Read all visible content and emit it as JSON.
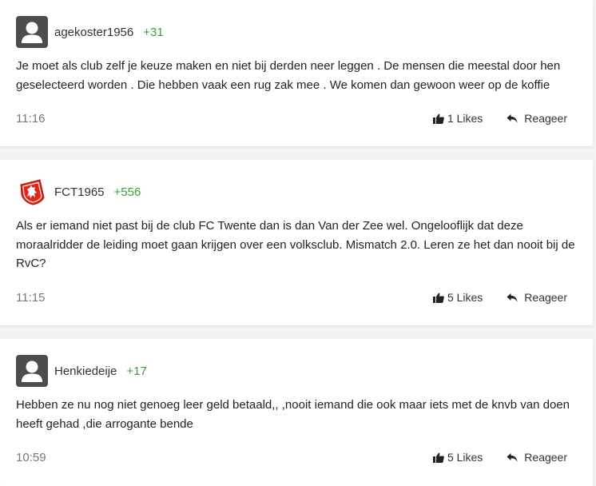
{
  "comments": [
    {
      "username": "agekoster1956",
      "score": "+31",
      "avatar_icon": "default-user-avatar",
      "text": "Je moet als club zelf je keuze maken en niet bij derden neer leggen . De mensen die meestal door hen geselecteerd worden . Die hebben vaak een rug zak mee . We komen dan gewoon weer op de koffie",
      "time": "11:16",
      "likes": "1 Likes",
      "reply": "Reageer"
    },
    {
      "username": "FCT1965",
      "score": "+556",
      "avatar_icon": "fc-twente-logo",
      "text": "Als er iemand niet past bij de club FC Twente dan is dan Van der Zee wel. Ongelooflijk dat deze moraalridder de leiding moet gaan krijgen over een volksclub. Mismatch 2.0. Leren ze het dan nooit bij de RvC?",
      "time": "11:15",
      "likes": "5 Likes",
      "reply": "Reageer"
    },
    {
      "username": "Henkiedeije",
      "score": "+17",
      "avatar_icon": "default-user-avatar",
      "text": "Hebben ze nu nog niet genoeg leer geld betaald,, ,nooit iemand die ook maar iets met de knvb van doen heeft gehad ,die arrogante bende",
      "time": "10:59",
      "likes": "5 Likes",
      "reply": "Reageer"
    }
  ],
  "colors": {
    "score_green": "#3a9d3a",
    "avatar_gray": "#4d4d4d",
    "logo_red": "#e2231a"
  }
}
